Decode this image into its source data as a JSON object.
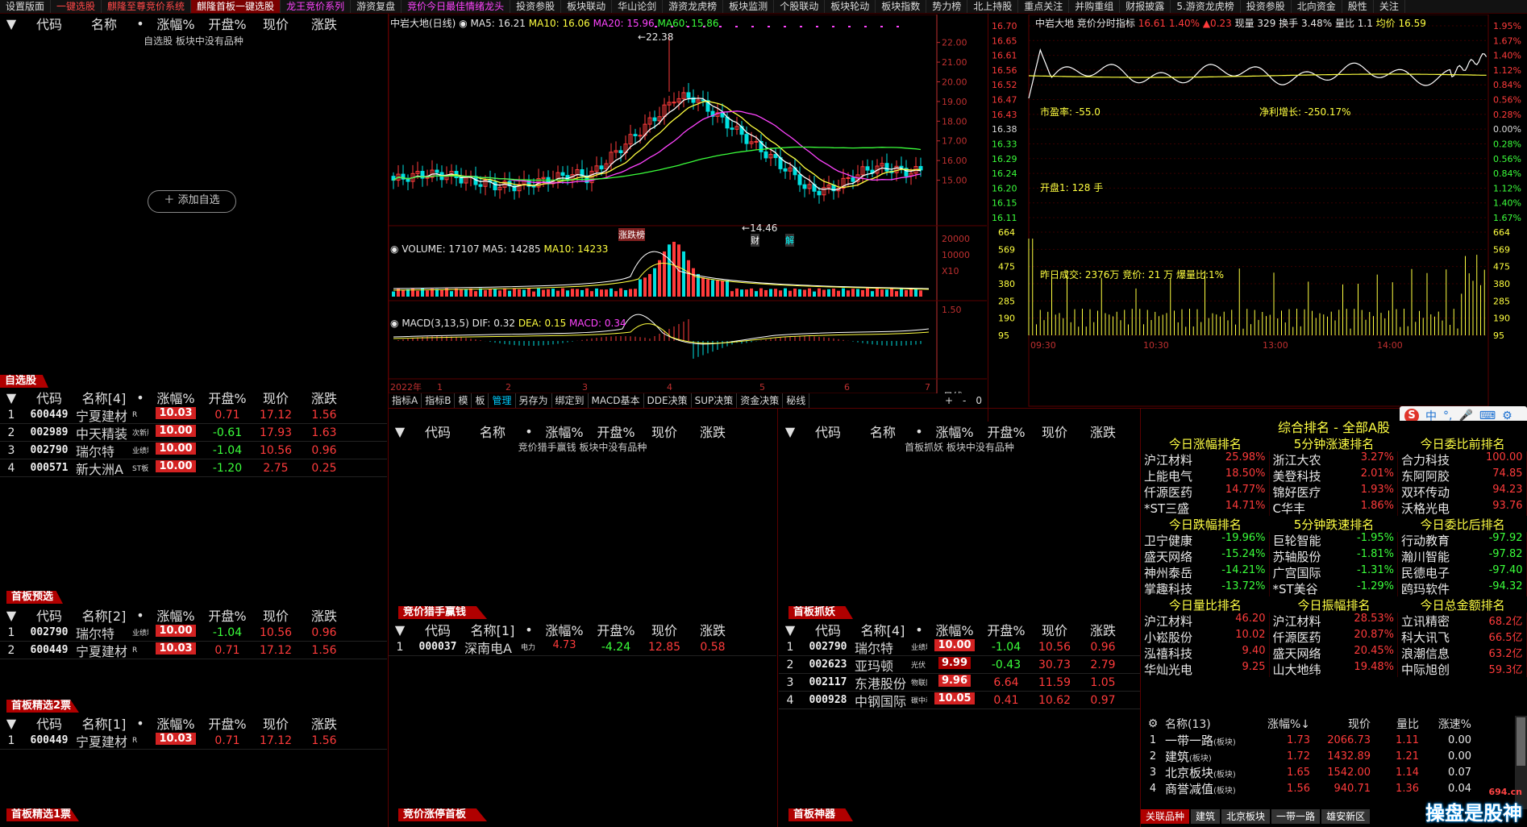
{
  "tabs": [
    "设置版面",
    "一键选股",
    "麒隆至尊竞价系统",
    "麒隆首板一键选股",
    "龙王竞价系列",
    "游资复盘",
    "竞价今日最佳情绪龙头",
    "投资参股",
    "板块联动",
    "华山论剑",
    "游资龙虎榜",
    "板块监测",
    "个股联动",
    "板块轮动",
    "板块指数",
    "势力榜",
    "北上持股",
    "重点关注",
    "并购重组",
    "财报披露",
    "5.游资龙虎榜",
    "投资参股",
    "北向资金",
    "股性",
    "关注"
  ],
  "colors": {
    "up": "#ff3b3b",
    "down": "#3bff3b",
    "accent": "#b00000",
    "yellow": "#ffff40"
  },
  "headers": {
    "code": "代码",
    "name": "名称",
    "dot": "•",
    "chg": "涨幅%",
    "open": "开盘%",
    "price": "现价",
    "diff": "涨跌"
  },
  "watchlist": {
    "empty_text": "自选股 板块中没有品种",
    "add_button": "添加自选",
    "section": "自选股"
  },
  "zixuan": {
    "name_header": "名称[4]",
    "rows": [
      {
        "i": "1",
        "code": "600449",
        "name": "宁夏建材",
        "tag": "R",
        "chg": "10.03",
        "open": "0.71",
        "price": "17.12",
        "diff": "1.56"
      },
      {
        "i": "2",
        "code": "002989",
        "name": "中天精装",
        "tag": "次新股",
        "chg": "10.00",
        "open": "-0.61",
        "price": "17.93",
        "diff": "1.63"
      },
      {
        "i": "3",
        "code": "002790",
        "name": "瑞尔特",
        "tag": "业绩增长",
        "chg": "10.00",
        "open": "-1.04",
        "price": "10.56",
        "diff": "0.96"
      },
      {
        "i": "4",
        "code": "000571",
        "name": "新大洲A",
        "tag": "ST板块",
        "chg": "10.00",
        "open": "-1.20",
        "price": "2.75",
        "diff": "0.25"
      }
    ],
    "section": "首板预选"
  },
  "yuxuan": {
    "name_header": "名称[2]",
    "rows": [
      {
        "i": "1",
        "code": "002790",
        "name": "瑞尔特",
        "tag": "业绩增长",
        "chg": "10.00",
        "open": "-1.04",
        "price": "10.56",
        "diff": "0.96"
      },
      {
        "i": "2",
        "code": "600449",
        "name": "宁夏建材",
        "tag": "R",
        "chg": "10.03",
        "open": "0.71",
        "price": "17.12",
        "diff": "1.56"
      }
    ],
    "section": "首板精选2票"
  },
  "jingxuan2": {
    "name_header": "名称[1]",
    "rows": [
      {
        "i": "1",
        "code": "600449",
        "name": "宁夏建材",
        "tag": "R",
        "chg": "10.03",
        "open": "0.71",
        "price": "17.12",
        "diff": "1.56"
      }
    ],
    "section": "首板精选1票"
  },
  "kline": {
    "title": "中岩大地(日线)",
    "ma5": "MA5: 16.21",
    "ma10": "MA10: 16.06",
    "ma20": "MA20: 15.96",
    "ma60": "MA60: 15.86",
    "high_label": "22.38",
    "low_label": "14.46",
    "marks": [
      "涨跌榜",
      "财",
      "解"
    ],
    "price_axis": [
      "22.00",
      "21.00",
      "20.00",
      "19.00",
      "18.00",
      "17.00",
      "16.00",
      "15.00"
    ],
    "vol_title": "VOLUME: 17107",
    "vol_ma5": "MA5: 14285",
    "vol_ma10": "MA10: 14233",
    "vol_axis": [
      "20000",
      "10000",
      "X10"
    ],
    "macd_title": "MACD(3,13,5)",
    "dif": "DIF: 0.32",
    "dea": "DEA: 0.15",
    "macd": "MACD: 0.34",
    "macd_axis": [
      "1.50"
    ],
    "date_axis": [
      "2022年",
      "1",
      "2",
      "3",
      "4",
      "5",
      "6",
      "7"
    ],
    "period": "日线",
    "toolbar": [
      "指标A",
      "指标B",
      "模",
      "板",
      "管理",
      "另存为",
      "绑定到",
      "MACD基本",
      "DDE决策",
      "SUP决策",
      "资金决策",
      "秘线"
    ],
    "zoom": [
      "+",
      "-",
      "0"
    ]
  },
  "intraday": {
    "title": "中岩大地",
    "indicator": "竞价分时指标",
    "price": "16.61",
    "pct": "1.40%",
    "chg": "▲0.23",
    "vol": "现量 329",
    "turn": "换手 3.48%",
    "ratio": "量比 1.1",
    "avg": "均价 16.59",
    "left_axis": [
      "16.70",
      "16.65",
      "16.61",
      "16.56",
      "16.52",
      "16.47",
      "16.43",
      "16.38",
      "16.33",
      "16.29",
      "16.24",
      "16.20",
      "16.15",
      "16.11"
    ],
    "right_axis": [
      "1.95%",
      "1.67%",
      "1.40%",
      "1.12%",
      "0.84%",
      "0.56%",
      "0.28%",
      "0.00%",
      "0.28%",
      "0.56%",
      "0.84%",
      "1.12%",
      "1.40%",
      "1.67%"
    ],
    "vol_left": [
      "664",
      "569",
      "475",
      "380",
      "285",
      "190",
      "95"
    ],
    "vol_right": [
      "664",
      "569",
      "475",
      "380",
      "285",
      "190",
      "95"
    ],
    "pe": "市盈率: -55.0",
    "profit": "净利增长: -250.17%",
    "open_vol": "开盘1: 128 手",
    "yday": "昨日成交: 2376万  竞价: 21 万  爆量比:1%",
    "time_axis": [
      "09:30",
      "10:30",
      "13:00",
      "14:00"
    ]
  },
  "jingjia": {
    "empty_text": "竞价猎手赢钱 板块中没有品种",
    "section": "竞价猎手赢钱",
    "name_header": "名称[1]",
    "rows": [
      {
        "i": "1",
        "code": "000037",
        "name": "深南电A",
        "tag": "电力",
        "chg": "4.73",
        "open": "-4.24",
        "price": "12.85",
        "diff": "0.58"
      }
    ],
    "section2": "竞价涨停首板"
  },
  "zhuayao": {
    "empty_text": "首板抓妖 板块中没有品种",
    "section": "首板抓妖",
    "name_header": "名称[4]",
    "rows": [
      {
        "i": "1",
        "code": "002790",
        "name": "瑞尔特",
        "tag": "业绩增长",
        "chg": "10.00",
        "open": "-1.04",
        "price": "10.56",
        "diff": "0.96"
      },
      {
        "i": "2",
        "code": "002623",
        "name": "亚玛顿",
        "tag": "光伏",
        "chg": "9.99",
        "open": "-0.43",
        "price": "30.73",
        "diff": "2.79"
      },
      {
        "i": "3",
        "code": "002117",
        "name": "东港股份",
        "tag": "物联网",
        "chg": "9.96",
        "open": "6.64",
        "price": "11.59",
        "diff": "1.05"
      },
      {
        "i": "4",
        "code": "000928",
        "name": "中钢国际",
        "tag": "碳中和",
        "chg": "10.05",
        "open": "0.41",
        "price": "10.62",
        "diff": "0.97"
      }
    ],
    "section2": "首板神器"
  },
  "ranking": {
    "title": "综合排名 - 全部A股",
    "blocks": [
      {
        "heads": [
          "今日涨幅排名",
          "5分钟涨速排名",
          "今日委比前排名"
        ],
        "rows": [
          [
            [
              "沪江材料",
              "25.98%"
            ],
            [
              "浙江大农",
              "3.27%"
            ],
            [
              "合力科技",
              "100.00"
            ]
          ],
          [
            [
              "上能电气",
              "18.50%"
            ],
            [
              "美登科技",
              "2.01%"
            ],
            [
              "东阿阿胶",
              "74.85"
            ]
          ],
          [
            [
              "仟源医药",
              "14.77%"
            ],
            [
              "锦好医疗",
              "1.93%"
            ],
            [
              "双环传动",
              "94.23"
            ]
          ],
          [
            [
              "*ST三盛",
              "14.71%"
            ],
            [
              "C华丰",
              "1.86%"
            ],
            [
              "沃格光电",
              "93.76"
            ]
          ]
        ]
      },
      {
        "heads": [
          "今日跌幅排名",
          "5分钟跌速排名",
          "今日委比后排名"
        ],
        "rows": [
          [
            [
              "卫宁健康",
              "-19.96%"
            ],
            [
              "巨轮智能",
              "-1.95%"
            ],
            [
              "行动教育",
              "-97.92"
            ]
          ],
          [
            [
              "盛天网络",
              "-15.24%"
            ],
            [
              "苏轴股份",
              "-1.81%"
            ],
            [
              "瀚川智能",
              "-97.82"
            ]
          ],
          [
            [
              "神州泰岳",
              "-14.21%"
            ],
            [
              "广宫国际",
              "-1.31%"
            ],
            [
              "民德电子",
              "-97.40"
            ]
          ],
          [
            [
              "掌趣科技",
              "-13.72%"
            ],
            [
              "*ST美谷",
              "-1.29%"
            ],
            [
              "鸥玛软件",
              "-94.32"
            ]
          ]
        ]
      },
      {
        "heads": [
          "今日量比排名",
          "今日振幅排名",
          "今日总金额排名"
        ],
        "rows": [
          [
            [
              "沪江材料",
              "46.20"
            ],
            [
              "沪江材料",
              "28.53%"
            ],
            [
              "立讯精密",
              "68.2亿"
            ]
          ],
          [
            [
              "小崧股份",
              "10.02"
            ],
            [
              "仟源医药",
              "20.87%"
            ],
            [
              "科大讯飞",
              "66.5亿"
            ]
          ],
          [
            [
              "泓禧科技",
              "9.40"
            ],
            [
              "盛天网络",
              "20.45%"
            ],
            [
              "浪潮信息",
              "63.2亿"
            ]
          ],
          [
            [
              "华灿光电",
              "9.25"
            ],
            [
              "山大地纬",
              "19.48%"
            ],
            [
              "中际旭创",
              "59.3亿"
            ]
          ]
        ]
      }
    ]
  },
  "sectors": {
    "heads": [
      "名称(13)",
      "涨幅%↓",
      "现价",
      "量比",
      "涨速%"
    ],
    "rows": [
      {
        "i": "1",
        "name": "一带一路",
        "type": "(板块)",
        "chg": "1.73",
        "price": "2066.73",
        "ratio": "1.11",
        "speed": "0.00"
      },
      {
        "i": "2",
        "name": "建筑",
        "type": "(板块)",
        "chg": "1.72",
        "price": "1432.89",
        "ratio": "1.21",
        "speed": "0.00"
      },
      {
        "i": "3",
        "name": "北京板块",
        "type": "(板块)",
        "chg": "1.65",
        "price": "1542.00",
        "ratio": "1.14",
        "speed": "0.07"
      },
      {
        "i": "4",
        "name": "商誉减值",
        "type": "(板块)",
        "chg": "1.56",
        "price": "940.71",
        "ratio": "1.36",
        "speed": "0.04"
      }
    ],
    "bottom_tabs": [
      "关联品种",
      "建筑",
      "北京板块",
      "一带一路",
      "雄安新区"
    ]
  },
  "ime": {
    "label": "中"
  },
  "watermark": "操盘是股神",
  "watermark_url": "694.cn"
}
